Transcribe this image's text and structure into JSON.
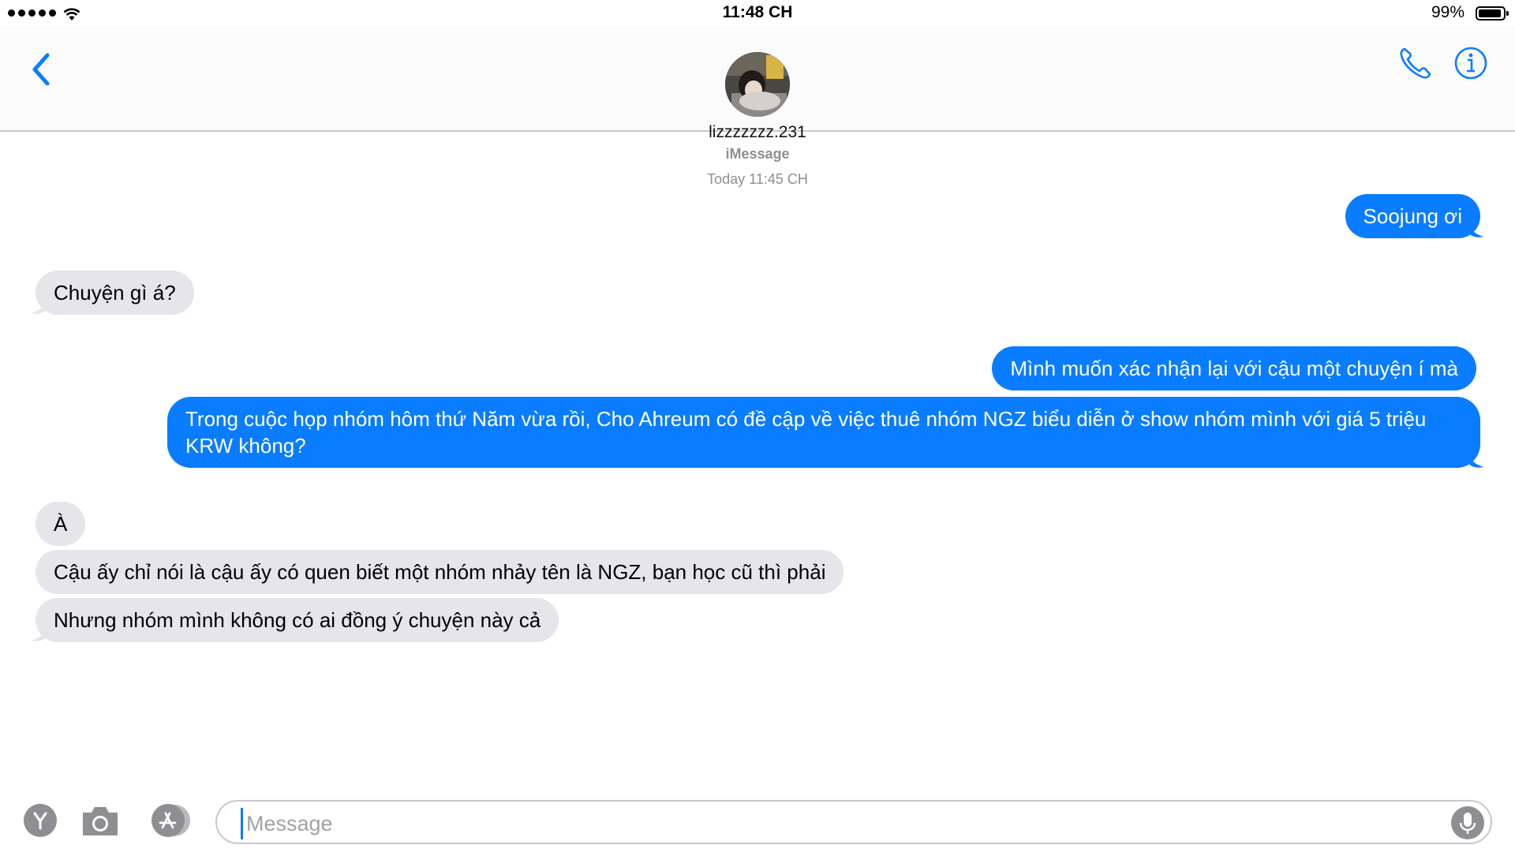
{
  "status_bar": {
    "time": "11:48 CH",
    "battery_percent": "99%",
    "battery_level": 0.99,
    "signal_bars": 5
  },
  "header": {
    "contact_name": "lizzzzzzz.231",
    "icons": {
      "back": "chevron-left-icon",
      "call": "phone-icon",
      "info": "info-icon"
    }
  },
  "conversation": {
    "service": "iMessage",
    "timestamp": "Today 11:45 CH",
    "messages": [
      {
        "from": "me",
        "text": "Soojung ơi"
      },
      {
        "from": "them",
        "text": "Chuyện gì á?"
      },
      {
        "from": "me",
        "text": "Mình muốn xác nhận lại với cậu một chuyện í mà"
      },
      {
        "from": "me",
        "text": "Trong cuộc họp nhóm hôm thứ Năm vừa rồi, Cho Ahreum có đề cập về việc thuê nhóm NGZ biểu diễn ở show nhóm mình với giá 5 triệu KRW không?"
      },
      {
        "from": "them",
        "text": "À"
      },
      {
        "from": "them",
        "text": "Cậu ấy chỉ nói là cậu ấy có quen biết một nhóm nhảy tên là NGZ, bạn học cũ thì phải"
      },
      {
        "from": "them",
        "text": "Nhưng nhóm mình không có ai đồng ý chuyện này cả"
      }
    ]
  },
  "input_bar": {
    "placeholder": "Message",
    "value": "",
    "icons": {
      "apps": "y-app-icon",
      "camera": "camera-icon",
      "app_store": "app-store-icon",
      "mic": "microphone-icon"
    }
  },
  "colors": {
    "sent_bubble": "#0a7cff",
    "received_bubble": "#e5e5ea",
    "accent": "#0a7cff",
    "meta_text": "#8e8e93"
  }
}
